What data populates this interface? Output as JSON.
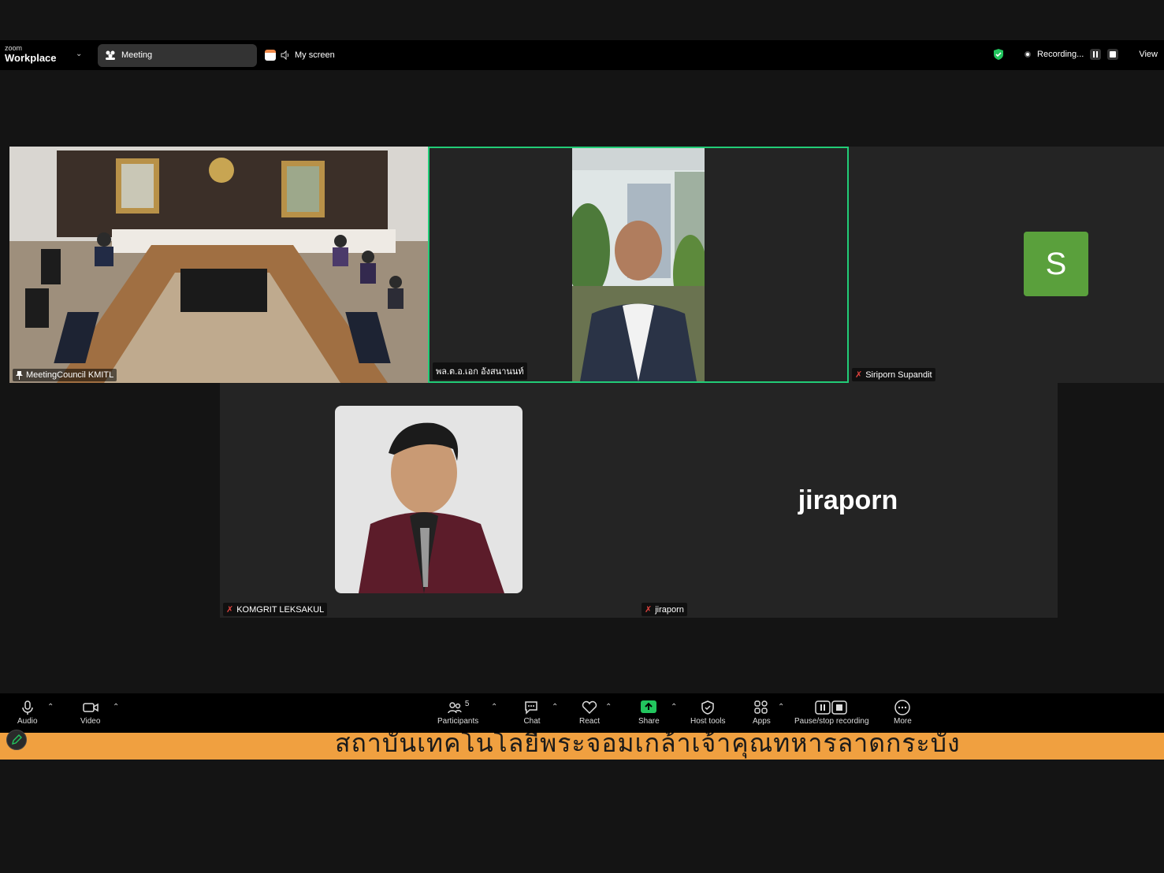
{
  "app": {
    "brand_small": "zoom",
    "brand": "Workplace"
  },
  "topbar": {
    "meeting_tab": "Meeting",
    "screen_tab": "My screen",
    "recording_label": "Recording...",
    "view_label": "View"
  },
  "tiles": [
    {
      "name": "MeetingCouncil KMITL",
      "muted": false
    },
    {
      "name": "พล.ต.อ.เอก อังสนานนท์",
      "muted": false,
      "active_speaker": true
    },
    {
      "name": "Siriporn Supandit",
      "muted": true,
      "avatar_letter": "S",
      "avatar_color": "#5aa03c"
    },
    {
      "name": "KOMGRIT LEKSAKUL",
      "muted": true
    },
    {
      "name": "jiraporn",
      "muted": true,
      "display_name": "jiraporn"
    }
  ],
  "toolbar": {
    "audio": "Audio",
    "video": "Video",
    "participants": "Participants",
    "participants_count": "5",
    "chat": "Chat",
    "react": "React",
    "share": "Share",
    "host_tools": "Host tools",
    "apps": "Apps",
    "pause_recording": "Pause/stop recording",
    "more": "More"
  },
  "caption": {
    "text": "สถาบันเทคโนโลยีพระจอมเกล้าเจ้าคุณทหารลาดกระบัง",
    "bg_color": "#f0a040"
  },
  "colors": {
    "active_border": "#22cc77",
    "muted_mic": "#e0433e",
    "share_green": "#22c55e"
  }
}
